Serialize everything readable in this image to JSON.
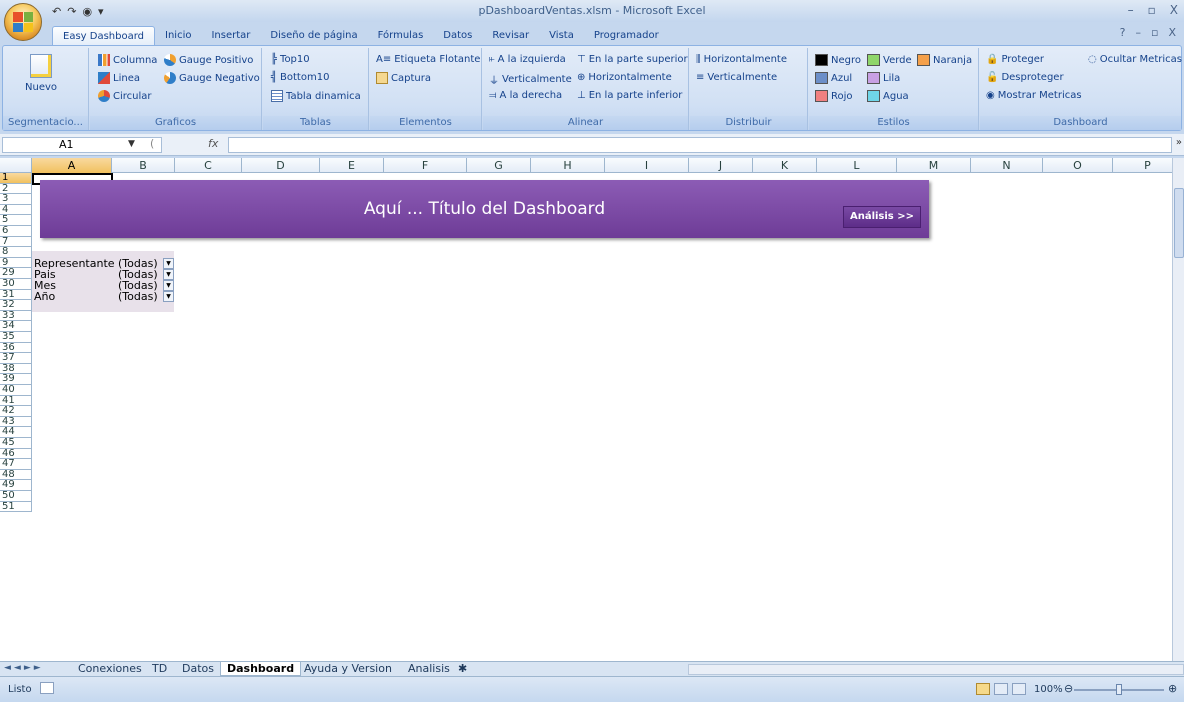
{
  "window": {
    "title": "pDashboardVentas.xlsm - Microsoft Excel",
    "controls": [
      "–",
      "▫",
      "X"
    ],
    "help_controls": [
      "?",
      "–",
      "▫",
      "X"
    ]
  },
  "tabs": [
    {
      "label": "Easy Dashboard",
      "active": true
    },
    {
      "label": "Inicio"
    },
    {
      "label": "Insertar"
    },
    {
      "label": "Diseño de página"
    },
    {
      "label": "Fórmulas"
    },
    {
      "label": "Datos"
    },
    {
      "label": "Revisar"
    },
    {
      "label": "Vista"
    },
    {
      "label": "Programador"
    }
  ],
  "ribbon": {
    "segmentacion": {
      "label": "Segmentacio...",
      "nuevo": "Nuevo"
    },
    "graficos": {
      "label": "Graficos",
      "columna": "Columna",
      "linea": "Linea",
      "circular": "Circular",
      "gauge_pos": "Gauge Positivo",
      "gauge_neg": "Gauge Negativo"
    },
    "tablas": {
      "label": "Tablas",
      "top10": "Top10",
      "bottom10": "Bottom10",
      "tabla_dinamica": "Tabla dinamica"
    },
    "elementos": {
      "label": "Elementos",
      "etiqueta": "Etiqueta Flotante",
      "captura": "Captura"
    },
    "alinear": {
      "label": "Alinear",
      "izquierda": "A la izquierda",
      "verticalmente": "Verticalmente",
      "derecha": "A la derecha",
      "superior": "En la parte superior",
      "horizontalmente": "Horizontalmente",
      "inferior": "En la parte inferior"
    },
    "distribuir": {
      "label": "Distribuir",
      "horizontalmente": "Horizontalmente",
      "verticalmente": "Verticalmente"
    },
    "estilos": {
      "label": "Estilos",
      "negro": "Negro",
      "verde": "Verde",
      "naranja": "Naranja",
      "azul": "Azul",
      "lila": "Lila",
      "rojo": "Rojo",
      "agua": "Agua",
      "colors": {
        "negro": "#000000",
        "verde": "#8fd66a",
        "naranja": "#f5a04a",
        "azul": "#6c8fc9",
        "lila": "#c8a0e4",
        "rojo": "#f08080",
        "agua": "#6fd6e8"
      }
    },
    "dashboard": {
      "label": "Dashboard",
      "proteger": "Proteger",
      "desproteger": "Desproteger",
      "mostrar": "Mostrar Metricas",
      "ocultar": "Ocultar Metricas"
    }
  },
  "formula_bar": {
    "name_box": "A1",
    "fx": "fx",
    "formula": ""
  },
  "columns": [
    "A",
    "B",
    "C",
    "D",
    "E",
    "F",
    "G",
    "H",
    "I",
    "J",
    "K",
    "L",
    "M",
    "N",
    "O",
    "P"
  ],
  "rows": [
    "1",
    "2",
    "3",
    "4",
    "5",
    "6",
    "7",
    "8",
    "9",
    "29",
    "30",
    "31",
    "32",
    "33",
    "34",
    "35",
    "36",
    "37",
    "38",
    "39",
    "40",
    "41",
    "42",
    "43",
    "44",
    "45",
    "46",
    "47",
    "48",
    "49",
    "50",
    "51"
  ],
  "dashboard": {
    "title": "Aquí ... Título del Dashboard",
    "analysis_button": "Análisis >>"
  },
  "filters": [
    {
      "label": "Representante",
      "value": "(Todas)"
    },
    {
      "label": "Pais",
      "value": "(Todas)"
    },
    {
      "label": "Mes",
      "value": "(Todas)"
    },
    {
      "label": "Año",
      "value": "(Todas)"
    }
  ],
  "sheets": [
    {
      "label": "Conexiones"
    },
    {
      "label": "TD"
    },
    {
      "label": "Datos"
    },
    {
      "label": "Dashboard",
      "active": true
    },
    {
      "label": "Ayuda y Version"
    },
    {
      "label": "Analisis"
    }
  ],
  "status": {
    "text": "Listo",
    "zoom": "100%"
  }
}
